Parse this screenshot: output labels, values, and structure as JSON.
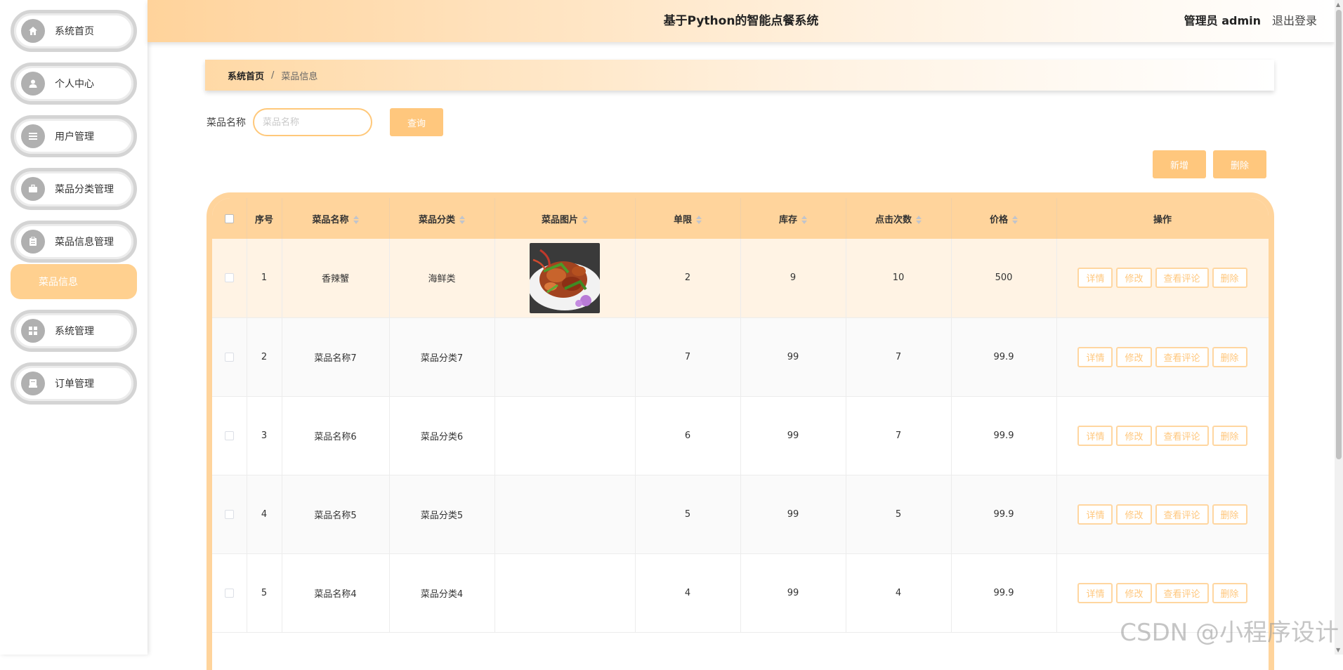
{
  "header": {
    "title": "基于Python的智能点餐系统",
    "user": "管理员 admin",
    "logout": "退出登录"
  },
  "sidebar": {
    "items": [
      {
        "label": "系统首页",
        "icon": "home-icon"
      },
      {
        "label": "个人中心",
        "icon": "user-icon"
      },
      {
        "label": "用户管理",
        "icon": "list-icon"
      },
      {
        "label": "菜品分类管理",
        "icon": "briefcase-icon"
      },
      {
        "label": "菜品信息管理",
        "icon": "clipboard-icon"
      },
      {
        "label": "系统管理",
        "icon": "grid-icon"
      },
      {
        "label": "订单管理",
        "icon": "receipt-icon"
      }
    ],
    "active_sub": "菜品信息"
  },
  "breadcrumb": {
    "home": "系统首页",
    "separator": "/",
    "current": "菜品信息"
  },
  "search": {
    "label": "菜品名称",
    "placeholder": "菜品名称",
    "button": "查询"
  },
  "actions": {
    "add": "新增",
    "delete": "删除"
  },
  "table": {
    "columns": [
      "序号",
      "菜品名称",
      "菜品分类",
      "菜品图片",
      "单限",
      "库存",
      "点击次数",
      "价格",
      "操作"
    ],
    "op_labels": [
      "详情",
      "修改",
      "查看评论",
      "删除"
    ],
    "rows": [
      {
        "no": "1",
        "name": "香辣蟹",
        "category": "海鲜类",
        "has_image": true,
        "limit": "2",
        "stock": "9",
        "clicks": "10",
        "price": "500"
      },
      {
        "no": "2",
        "name": "菜品名称7",
        "category": "菜品分类7",
        "has_image": false,
        "limit": "7",
        "stock": "99",
        "clicks": "7",
        "price": "99.9"
      },
      {
        "no": "3",
        "name": "菜品名称6",
        "category": "菜品分类6",
        "has_image": false,
        "limit": "6",
        "stock": "99",
        "clicks": "7",
        "price": "99.9"
      },
      {
        "no": "4",
        "name": "菜品名称5",
        "category": "菜品分类5",
        "has_image": false,
        "limit": "5",
        "stock": "99",
        "clicks": "5",
        "price": "99.9"
      },
      {
        "no": "5",
        "name": "菜品名称4",
        "category": "菜品分类4",
        "has_image": false,
        "limit": "4",
        "stock": "99",
        "clicks": "4",
        "price": "99.9"
      }
    ]
  },
  "watermark": "CSDN @小程序设计",
  "colors": {
    "accent": "#ffc77d",
    "header_gradient_start": "#ffd39b",
    "table_header": "#ffd49c"
  }
}
